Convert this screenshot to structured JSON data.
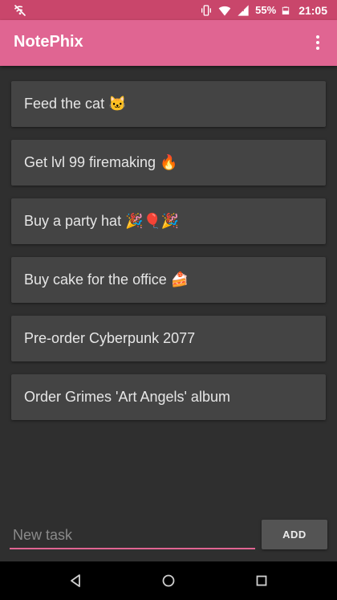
{
  "status_bar": {
    "battery_percent": "55%",
    "time": "21:05",
    "icons": [
      "no-notifications-icon",
      "vibrate-icon",
      "wifi-icon",
      "signal-icon",
      "battery-icon"
    ]
  },
  "app_bar": {
    "title": "NotePhix",
    "overflow_icon": "more-vert-icon"
  },
  "tasks": [
    {
      "text": "Feed the cat 🐱"
    },
    {
      "text": "Get lvl 99 firemaking 🔥"
    },
    {
      "text": "Buy a party hat 🎉🎈🎉"
    },
    {
      "text": "Buy cake for the office 🍰"
    },
    {
      "text": "Pre-order Cyberpunk 2077"
    },
    {
      "text": "Order Grimes 'Art Angels' album"
    }
  ],
  "input": {
    "placeholder": "New task",
    "value": ""
  },
  "add_button": {
    "label": "ADD"
  },
  "navigation": {
    "icons": [
      "back-icon",
      "home-icon",
      "recents-icon"
    ]
  },
  "colors": {
    "status_bar": "#c9466b",
    "app_bar": "#e06592",
    "background": "#2f2f2f",
    "card": "#444444",
    "accent": "#e06592"
  }
}
